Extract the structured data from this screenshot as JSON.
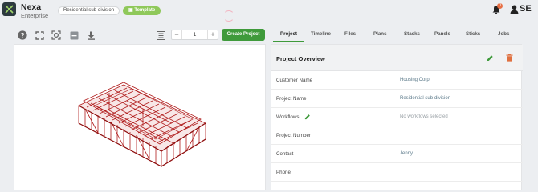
{
  "header": {
    "app_name": "Nexa",
    "app_sub": "Enterprise",
    "project_chip": "Residential sub-division",
    "template_chip": "Template",
    "notification_count": "0",
    "user_initials": "SE"
  },
  "toolbar": {
    "quantity": "1",
    "minus": "−",
    "plus": "+",
    "create_label": "Create Project"
  },
  "tabs": [
    "Project",
    "Timeline",
    "Files",
    "Plans",
    "Stacks",
    "Panels",
    "Sticks",
    "Jobs"
  ],
  "panel": {
    "title": "Project Overview",
    "rows": [
      {
        "label": "Customer Name",
        "value": "Housing Corp"
      },
      {
        "label": "Project Name",
        "value": "Residential sub-division"
      },
      {
        "label": "Workflows",
        "value": "No workflows selected"
      },
      {
        "label": "Project Number",
        "value": ""
      },
      {
        "label": "Contact",
        "value": "Jenny"
      },
      {
        "label": "Phone",
        "value": ""
      }
    ]
  },
  "colors": {
    "accent": "#3f9a3b",
    "template": "#8fc85a",
    "frame": "#b01c1c",
    "badge": "#e76f45"
  }
}
